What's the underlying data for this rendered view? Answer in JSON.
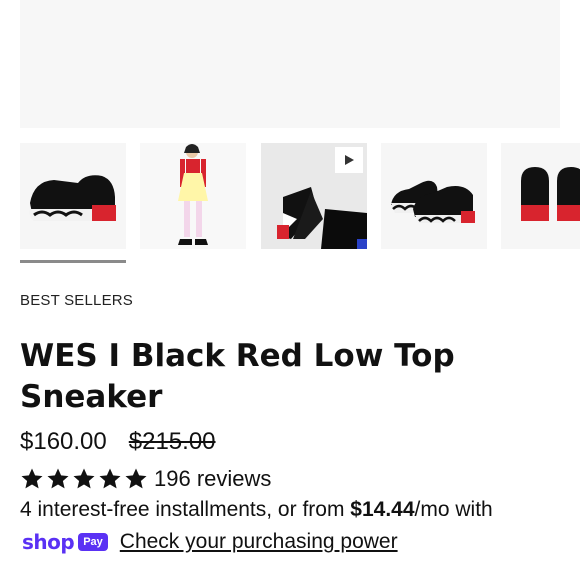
{
  "gallery": {
    "thumbnails": [
      {
        "alt": "black sneaker side view",
        "icon": "product-photo"
      },
      {
        "alt": "model wearing sneakers",
        "icon": "product-photo"
      },
      {
        "alt": "video thumbnail",
        "icon": "play-icon"
      },
      {
        "alt": "pair of sneakers",
        "icon": "product-photo"
      },
      {
        "alt": "sneakers back view",
        "icon": "product-photo"
      }
    ],
    "active_index": 0
  },
  "product": {
    "eyebrow": "BEST SELLERS",
    "title": "WES I Black Red Low Top Sneaker",
    "price": "$160.00",
    "compare_price": "$215.00",
    "rating_stars": 5,
    "reviews_label": "196 reviews"
  },
  "installments": {
    "prefix": "4 interest-free installments, or from ",
    "amount": "$14.44",
    "suffix": "/mo with"
  },
  "shop_pay": {
    "brand_word": "shop",
    "badge": "Pay",
    "link_label": "Check your purchasing power",
    "brand_color": "#5a31f4"
  },
  "colors": {
    "accent_red": "#d8242e",
    "shoe_black": "#111111"
  }
}
